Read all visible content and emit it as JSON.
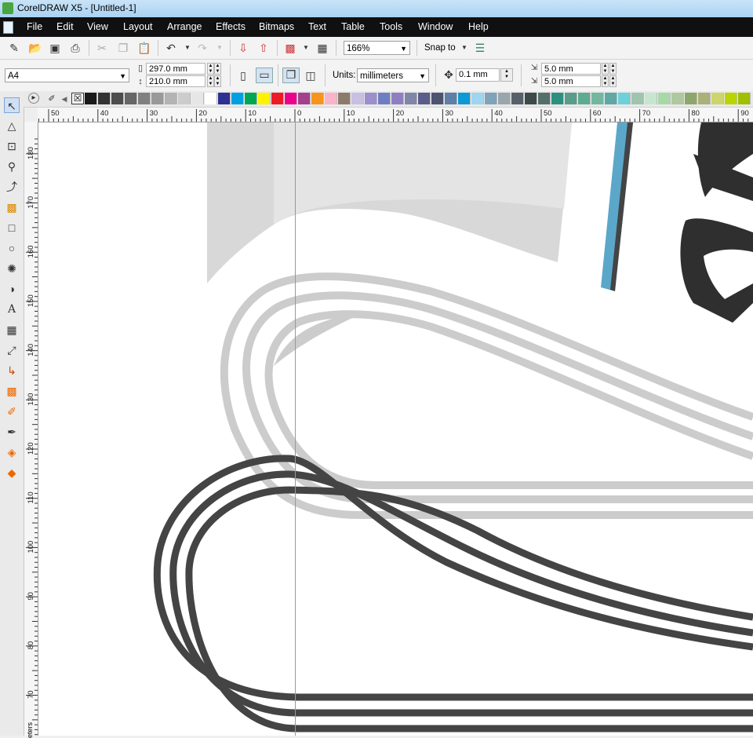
{
  "window": {
    "title": "CorelDRAW X5 - [Untitled-1]"
  },
  "menu": [
    "File",
    "Edit",
    "View",
    "Layout",
    "Arrange",
    "Effects",
    "Bitmaps",
    "Text",
    "Table",
    "Tools",
    "Window",
    "Help"
  ],
  "standard_toolbar": {
    "zoom_level": "166%",
    "snap_to_label": "Snap to",
    "icons": [
      "new-icon",
      "open-icon",
      "save-icon",
      "print-icon",
      "cut-icon",
      "copy-icon",
      "paste-icon",
      "undo-icon",
      "redo-icon",
      "import-icon",
      "export-icon",
      "app-launcher-icon",
      "welcome-screen-icon",
      "options-icon"
    ]
  },
  "property_bar": {
    "page_size": "A4",
    "page_width": "297.0 mm",
    "page_height": "210.0 mm",
    "units_label": "Units:",
    "units_value": "millimeters",
    "nudge_value": "0.1 mm",
    "duplicate_x": "5.0 mm",
    "duplicate_y": "5.0 mm"
  },
  "palette": {
    "colors": [
      "#1a1a1a",
      "#333333",
      "#4d4d4d",
      "#666666",
      "#808080",
      "#999999",
      "#b3b3b3",
      "#cccccc",
      "#e6e6e6",
      "#ffffff",
      "#2e3192",
      "#00a0e3",
      "#00a651",
      "#fff200",
      "#ed1c24",
      "#ec008c",
      "#a3418d",
      "#f7941d",
      "#f9b4c9",
      "#8c7b6b",
      "#c8c0e0",
      "#9b8fce",
      "#6f7ec2",
      "#8f7fc0",
      "#7f86a8",
      "#5a5c8a",
      "#4d5470",
      "#5d7fa8",
      "#0d99d5",
      "#9dd6f0",
      "#7fa3b8",
      "#9aa6ad",
      "#57606a",
      "#3d4a4a",
      "#55706b",
      "#2f8f7f",
      "#5a9c8a",
      "#5faa92",
      "#74b6a0",
      "#5fa8a6",
      "#6ed0d8",
      "#a0c4b0",
      "#c6e6d0",
      "#a8d8a8",
      "#b0c8a0",
      "#8fa66b",
      "#a9b07a",
      "#cdd46b",
      "#bad400",
      "#9fbf00"
    ]
  },
  "rulers": {
    "horizontal": [
      "50",
      "40",
      "30",
      "20",
      "10",
      "0",
      "10",
      "20",
      "30",
      "40",
      "50",
      "60",
      "70",
      "80",
      "90"
    ],
    "vertical": [
      "180",
      "170",
      "160",
      "150",
      "140",
      "130",
      "120",
      "110",
      "100",
      "90",
      "80",
      "70"
    ],
    "unit_label": "eters"
  },
  "toolbox": [
    "pick-tool-icon",
    "shape-tool-icon",
    "crop-tool-icon",
    "zoom-tool-icon",
    "freehand-tool-icon",
    "smart-fill-icon",
    "rectangle-tool-icon",
    "ellipse-tool-icon",
    "spiral-tool-icon",
    "basic-shapes-icon",
    "text-tool-icon",
    "table-tool-icon",
    "dimension-tool-icon",
    "connector-tool-icon",
    "blend-tool-icon",
    "eyedropper-tool-icon",
    "outline-pen-icon",
    "fill-tool-icon",
    "interactive-fill-icon"
  ],
  "colors": {
    "curve_dark": "#444444",
    "curve_light": "#cccccc",
    "accent_blue": "#5ba7c9",
    "titlebar": "#b9dbf5",
    "menubar": "#101010"
  }
}
